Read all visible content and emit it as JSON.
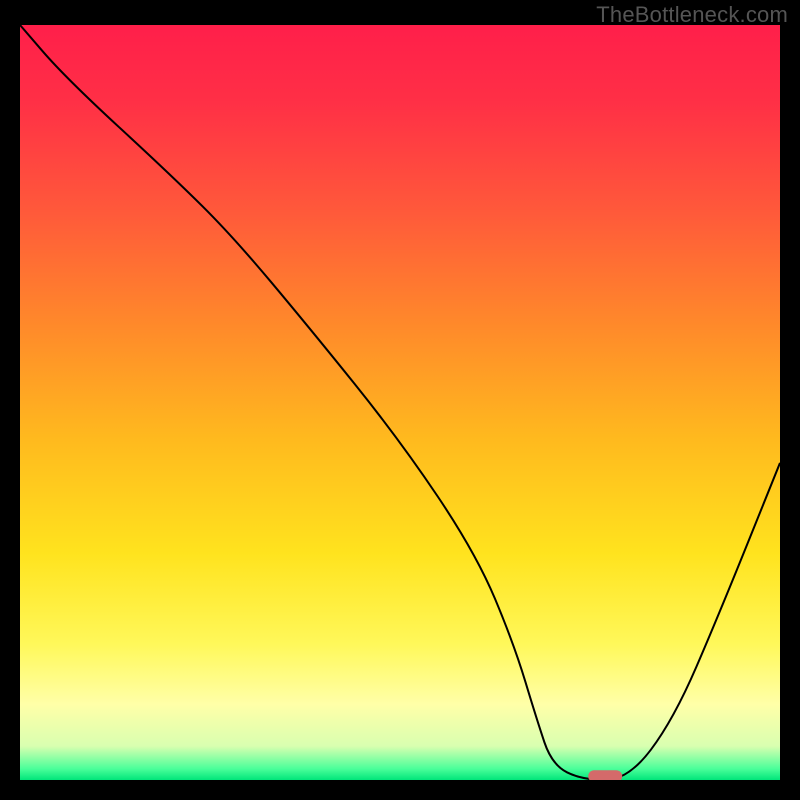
{
  "watermark": "TheBottleneck.com",
  "chart_data": {
    "type": "line",
    "title": "",
    "xlabel": "",
    "ylabel": "",
    "xlim": [
      0,
      100
    ],
    "ylim": [
      0,
      100
    ],
    "grid": false,
    "x": [
      0,
      6,
      20,
      28,
      38,
      50,
      60,
      65,
      68,
      70,
      74,
      80,
      86,
      92,
      100
    ],
    "values": [
      100,
      93,
      80,
      72,
      60,
      45,
      30,
      18,
      8,
      2,
      0,
      0,
      8,
      22,
      42
    ],
    "marker": {
      "x": 77,
      "y": 0.5,
      "color": "#d46a6a"
    },
    "background": {
      "stops": [
        {
          "pos": 0.0,
          "color": "#ff1f4a"
        },
        {
          "pos": 0.1,
          "color": "#ff2f46"
        },
        {
          "pos": 0.25,
          "color": "#ff5a3a"
        },
        {
          "pos": 0.4,
          "color": "#ff8a2a"
        },
        {
          "pos": 0.55,
          "color": "#ffba1e"
        },
        {
          "pos": 0.7,
          "color": "#ffe31e"
        },
        {
          "pos": 0.82,
          "color": "#fff85a"
        },
        {
          "pos": 0.9,
          "color": "#ffffa8"
        },
        {
          "pos": 0.955,
          "color": "#d9ffb0"
        },
        {
          "pos": 0.985,
          "color": "#4bff9a"
        },
        {
          "pos": 1.0,
          "color": "#00e57a"
        }
      ]
    },
    "line_color": "#000000",
    "line_width": 2
  }
}
